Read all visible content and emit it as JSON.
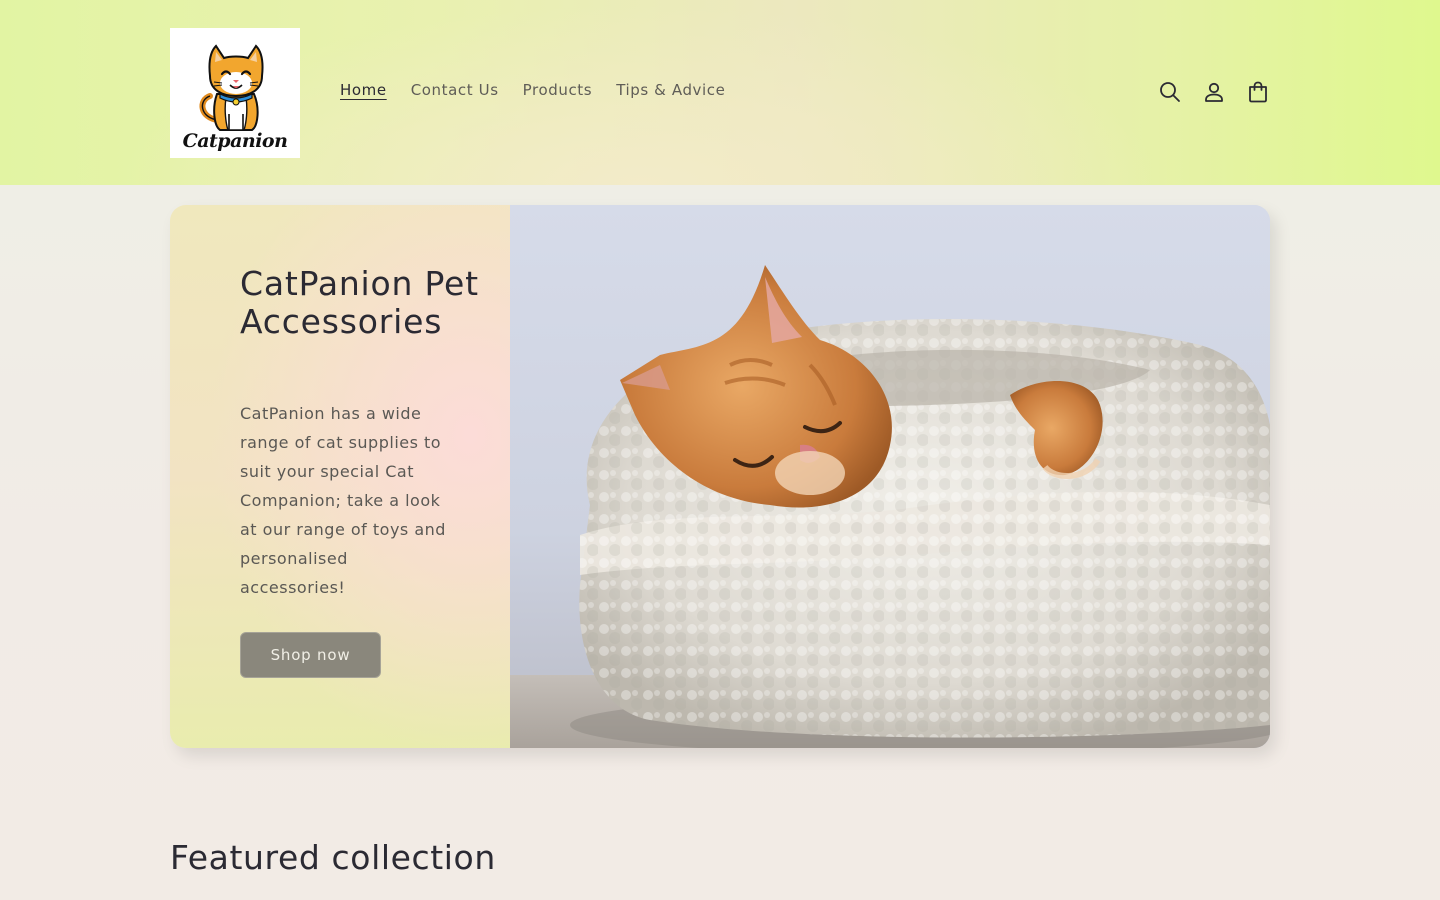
{
  "brand": {
    "logo_text": "Catpanion",
    "logo_icon": "cat-mascot-icon"
  },
  "nav": {
    "items": [
      {
        "label": "Home",
        "active": true
      },
      {
        "label": "Contact Us",
        "active": false
      },
      {
        "label": "Products",
        "active": false
      },
      {
        "label": "Tips & Advice",
        "active": false
      }
    ]
  },
  "header_icons": [
    "search-icon",
    "account-icon",
    "cart-icon"
  ],
  "hero": {
    "title": "CatPanion Pet Accessories",
    "text": "CatPanion has a wide range of cat supplies to suit your special Cat Companion; take a look at our range of toys and personalised accessories!",
    "button_label": "Shop now",
    "image": "sleeping ginger cat in white fluffy bed"
  },
  "featured": {
    "title": "Featured collection"
  },
  "colors": {
    "header_accent": "#dff88e",
    "button_bg": "#8a877c",
    "text": "#2b2a33"
  }
}
